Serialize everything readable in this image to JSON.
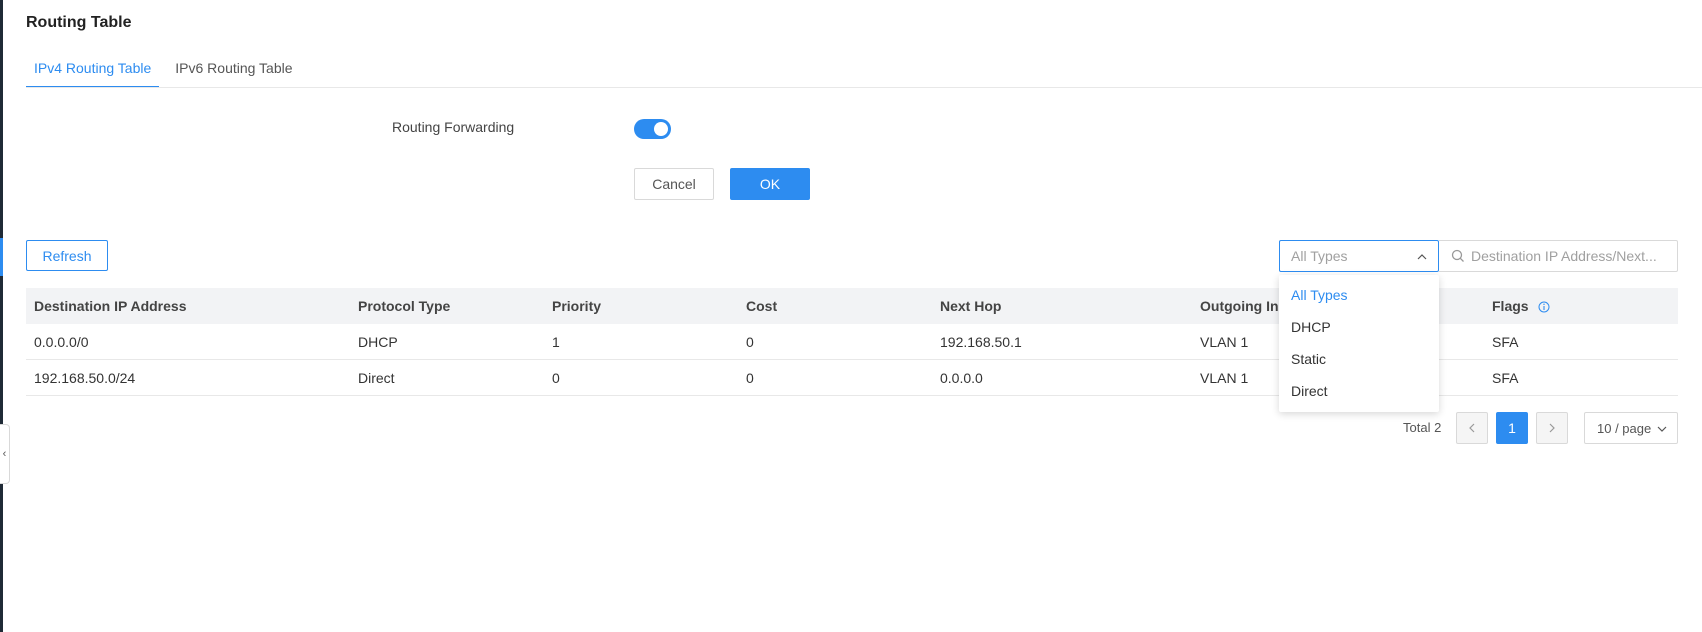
{
  "page": {
    "title": "Routing Table"
  },
  "tabs": [
    {
      "label": "IPv4 Routing Table",
      "active": true
    },
    {
      "label": "IPv6 Routing Table",
      "active": false
    }
  ],
  "form": {
    "routing_forwarding_label": "Routing Forwarding",
    "routing_forwarding_enabled": true,
    "cancel_label": "Cancel",
    "ok_label": "OK"
  },
  "toolbar": {
    "refresh_label": "Refresh",
    "type_filter": {
      "placeholder": "All Types",
      "options": [
        "All Types",
        "DHCP",
        "Static",
        "Direct"
      ],
      "selected": "All Types",
      "open": true
    },
    "search_placeholder": "Destination IP Address/Next..."
  },
  "table": {
    "headers": [
      "Destination IP Address",
      "Protocol Type",
      "Priority",
      "Cost",
      "Next Hop",
      "Outgoing In",
      "Flags"
    ],
    "rows": [
      [
        "0.0.0.0/0",
        "DHCP",
        "1",
        "0",
        "192.168.50.1",
        "VLAN 1",
        "SFA"
      ],
      [
        "192.168.50.0/24",
        "Direct",
        "0",
        "0",
        "0.0.0.0",
        "VLAN 1",
        "SFA"
      ]
    ]
  },
  "pagination": {
    "total_label": "Total 2",
    "current_page": "1",
    "page_size_label": "10 / page"
  },
  "colors": {
    "accent": "#2d8cf0",
    "header_bg": "#f2f3f5",
    "sidebar_dark": "#1f2a36"
  },
  "icons": {
    "select_chevron": "chevron-up-icon",
    "search": "search-icon",
    "flags_info": "info-circle-icon",
    "prev": "chevron-left-icon",
    "next": "chevron-right-icon",
    "page_size_chevron": "chevron-down-icon"
  }
}
